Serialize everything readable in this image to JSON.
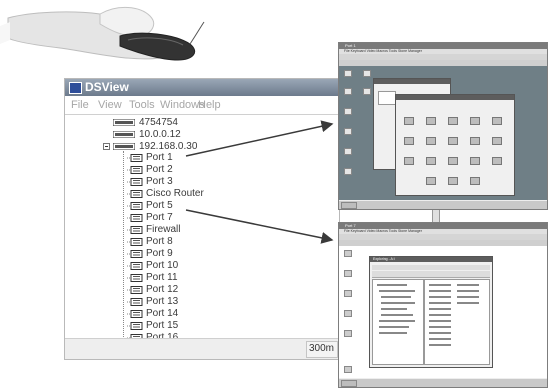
{
  "dsview": {
    "title": "DSView",
    "menu": [
      "File",
      "View",
      "Tools",
      "Windows",
      "Help"
    ],
    "appliances": [
      "4754754",
      "10.0.0.12",
      "192.168.0.30"
    ],
    "ports": [
      "Port 1",
      "Port 2",
      "Port 3",
      "Cisco Router",
      "Port 5",
      "Port 7",
      "Firewall",
      "Port 8",
      "Port 9",
      "Port 10",
      "Port 11",
      "Port 12",
      "Port 13",
      "Port 14",
      "Port 15",
      "Port 16"
    ],
    "status_right": "300m"
  },
  "screen1": {
    "title": "Port 1",
    "menu": "File  Keyboard  Video  Macros  Tools  Stone Manager"
  },
  "screen2": {
    "title": "Port 7",
    "menu": "File  Keyboard  Video  Macros  Tools  Stone Manager",
    "window_title": "Exploring - A:\\"
  },
  "colors": {
    "title_bar": "#6c7a8c",
    "remote_desktop": "#6f7f86",
    "arrow": "#3a3a3a"
  }
}
